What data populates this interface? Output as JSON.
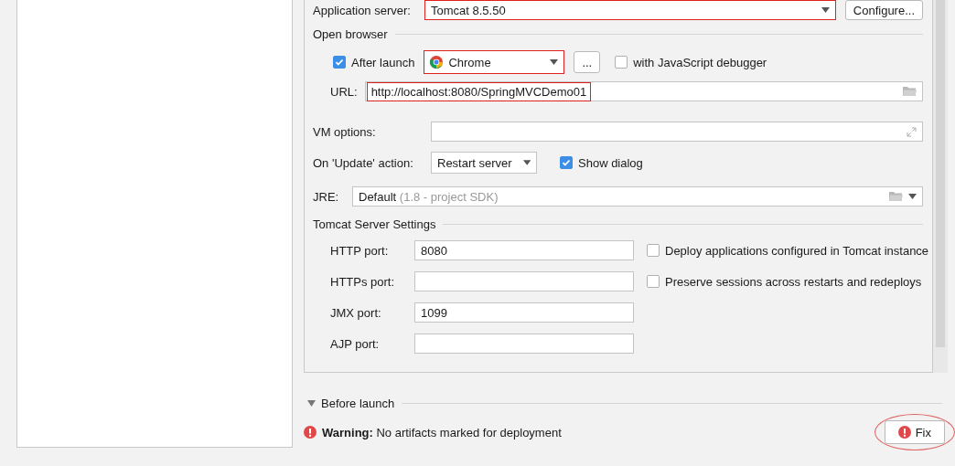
{
  "application_server": {
    "label": "Application server:",
    "value": "Tomcat 8.5.50",
    "highlighted": true,
    "button": "Configure..."
  },
  "open_browser": {
    "title": "Open browser",
    "after_launch": {
      "label": "After launch",
      "checked": true
    },
    "browser": {
      "value": "Chrome",
      "highlighted": true
    },
    "more_button": "...",
    "js_debugger": {
      "label": "with JavaScript debugger",
      "checked": false
    },
    "url": {
      "label": "URL:",
      "value": "http://localhost:8080/SpringMVCDemo01",
      "highlighted": true
    }
  },
  "vm_options": {
    "label": "VM options:"
  },
  "update_action": {
    "label": "On 'Update' action:",
    "value": "Restart server",
    "show_dialog": {
      "label": "Show dialog",
      "checked": true
    }
  },
  "jre": {
    "label": "JRE:",
    "value": "Default",
    "hint": "(1.8 - project SDK)"
  },
  "tomcat_settings": {
    "title": "Tomcat Server Settings",
    "ports": [
      {
        "label": "HTTP port:",
        "value": "8080"
      },
      {
        "label": "HTTPs port:"
      },
      {
        "label": "JMX port:",
        "value": "1099"
      },
      {
        "label": "AJP port:"
      }
    ],
    "options": [
      {
        "label": "Deploy applications configured in Tomcat instance",
        "checked": false
      },
      {
        "label": "Preserve sessions across restarts and redeploys",
        "checked": false
      }
    ]
  },
  "before_launch": {
    "label": "Before launch",
    "expanded": false
  },
  "warning": {
    "title": "Warning:",
    "message": "No artifacts marked for deployment",
    "fix_button": "Fix",
    "fix_circled": true
  }
}
